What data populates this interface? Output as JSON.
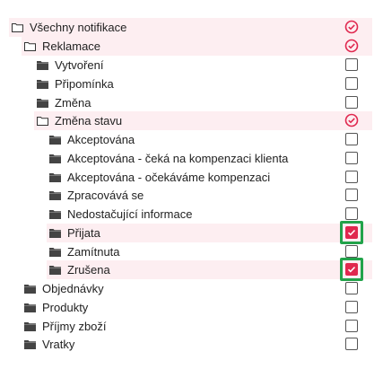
{
  "colors": {
    "accent": "#e0284f",
    "highlight_bg": "#fdeef1",
    "focus_frame": "#22a34a"
  },
  "tree": {
    "root": {
      "label": "Všechny notifikace",
      "state": "circle-check",
      "icon": "folder-open-icon"
    },
    "reklamace": {
      "label": "Reklamace",
      "state": "circle-check",
      "icon": "folder-open-icon"
    },
    "vytvoreni": {
      "label": "Vytvoření",
      "state": "unchecked",
      "icon": "folder-icon"
    },
    "pripominka": {
      "label": "Připomínka",
      "state": "unchecked",
      "icon": "folder-icon"
    },
    "zmena": {
      "label": "Změna",
      "state": "unchecked",
      "icon": "folder-icon"
    },
    "zmena_stavu": {
      "label": "Změna stavu",
      "state": "circle-check",
      "icon": "folder-open-icon"
    },
    "akceptovana": {
      "label": "Akceptována",
      "state": "unchecked",
      "icon": "folder-icon"
    },
    "akceptovana_ceka": {
      "label": "Akceptována - čeká na kompenzaci klienta",
      "state": "unchecked",
      "icon": "folder-icon"
    },
    "akceptovana_ocekavame": {
      "label": "Akceptována - očekáváme kompenzaci",
      "state": "unchecked",
      "icon": "folder-icon"
    },
    "zpracovava": {
      "label": "Zpracovává se",
      "state": "unchecked",
      "icon": "folder-icon"
    },
    "nedostacujici": {
      "label": "Nedostačující informace",
      "state": "unchecked",
      "icon": "folder-icon"
    },
    "prijata": {
      "label": "Přijata",
      "state": "checked",
      "icon": "folder-icon"
    },
    "zamitnuta": {
      "label": "Zamítnuta",
      "state": "unchecked",
      "icon": "folder-icon"
    },
    "zrusena": {
      "label": "Zrušena",
      "state": "checked",
      "icon": "folder-icon"
    },
    "objednavky": {
      "label": "Objednávky",
      "state": "unchecked",
      "icon": "folder-icon"
    },
    "produkty": {
      "label": "Produkty",
      "state": "unchecked",
      "icon": "folder-icon"
    },
    "prijmy_zbozi": {
      "label": "Příjmy zboží",
      "state": "unchecked",
      "icon": "folder-icon"
    },
    "vratky": {
      "label": "Vratky",
      "state": "unchecked",
      "icon": "folder-icon"
    }
  }
}
